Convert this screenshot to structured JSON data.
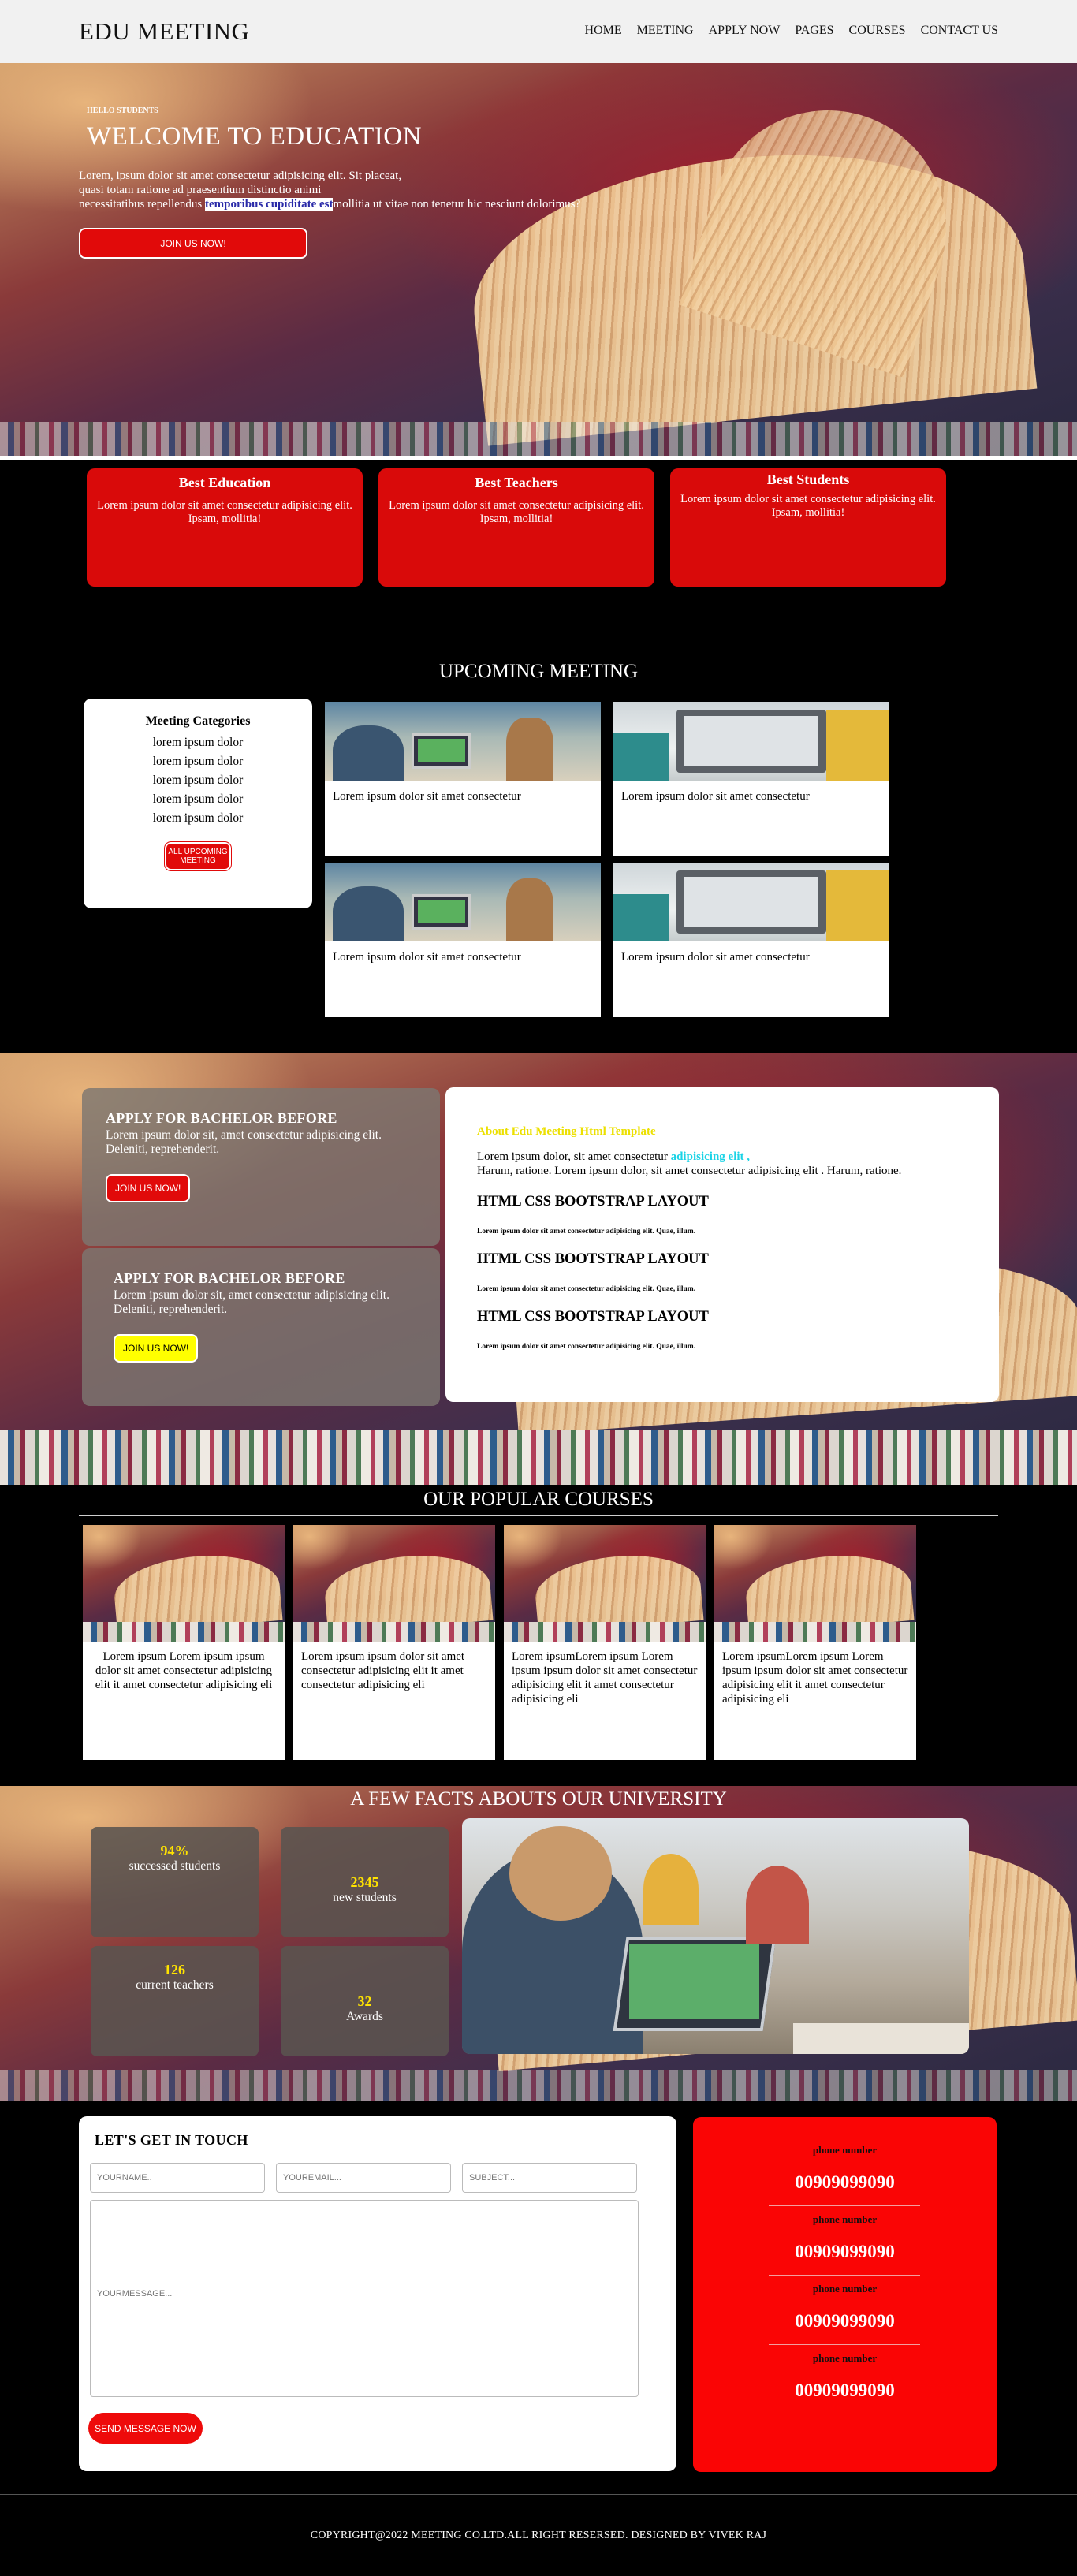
{
  "header": {
    "logo": "EDU MEETING",
    "nav": [
      "HOME",
      "MEETING",
      "APPLY NOW",
      "PAGES",
      "COURSES",
      "CONTACT US"
    ]
  },
  "hero": {
    "kicker": "HELLO STUDENTS",
    "title": "WELCOME TO EDUCATION",
    "text_line1": "Lorem, ipsum dolor sit amet consectetur adipisicing elit. Sit placeat,",
    "text_line2": "quasi totam ratione ad praesentium distinctio animi",
    "text_line3a": "necessitatibus repellendus",
    "text_highlight": "temporibus cupiditate est",
    "text_line3b": "mollitia ut vitae non tenetur hic nesciunt dolorimus?",
    "button": "JOIN US NOW!"
  },
  "features": [
    {
      "title": "Best Education",
      "text": "Lorem ipsum dolor sit amet consectetur adipisicing elit. Ipsam, mollitia!"
    },
    {
      "title": "Best Teachers",
      "text": "Lorem ipsum dolor sit amet consectetur adipisicing elit. Ipsam, mollitia!"
    },
    {
      "title": "Best Students",
      "text": "Lorem ipsum dolor sit amet consectetur adipisicing elit. Ipsam, mollitia!"
    }
  ],
  "upcoming": {
    "title": "UPCOMING MEETING",
    "categories_title": "Meeting Categories",
    "categories": [
      "lorem ipsum dolor",
      "lorem ipsum dolor",
      "lorem ipsum dolor",
      "lorem ipsum dolor",
      "lorem ipsum dolor"
    ],
    "categories_button": "ALL UPCOMING MEETING",
    "cards": [
      {
        "text": "Lorem ipsum dolor sit amet consectetur"
      },
      {
        "text": "Lorem ipsum dolor sit amet consectetur"
      },
      {
        "text": "Lorem ipsum dolor sit amet consectetur"
      },
      {
        "text": "Lorem ipsum dolor sit amet consectetur"
      }
    ]
  },
  "apply": [
    {
      "title": "APPLY FOR BACHELOR BEFORE",
      "text": "Lorem ipsum dolor sit, amet consectetur adipisicing elit. Deleniti, reprehenderit.",
      "button": "JOIN US NOW!",
      "button_color": "#e10a0a"
    },
    {
      "title": "APPLY FOR BACHELOR BEFORE",
      "text": "Lorem ipsum dolor sit, amet consectetur adipisicing elit. Deleniti, reprehenderit.",
      "button": "JOIN US NOW!",
      "button_color": "#ffff00"
    }
  ],
  "about": {
    "label": "About Edu Meeting Html Template",
    "body_a": "Lorem ipsum dolor, sit amet consectetur",
    "body_highlight": "adipisicing elit ,",
    "body_b": "Harum, ratione. Lorem ipsum dolor, sit amet consectetur adipisicing elit . Harum, ratione.",
    "items": [
      {
        "heading": "HTML CSS BOOTSTRAP LAYOUT",
        "text": "Lorem ipsum dolor sit amet consectetur adipisicing elit. Quae, illum."
      },
      {
        "heading": "HTML CSS BOOTSTRAP LAYOUT",
        "text": "Lorem ipsum dolor sit amet consectetur adipisicing elit. Quae, illum."
      },
      {
        "heading": "HTML CSS BOOTSTRAP LAYOUT",
        "text": "Lorem ipsum dolor sit amet consectetur adipisicing elit. Quae, illum."
      }
    ]
  },
  "courses": {
    "title": "OUR POPULAR COURSES",
    "items": [
      {
        "text": "Lorem ipsum Lorem ipsum ipsum dolor sit amet consectetur adipisicing elit it amet consectetur adipisicing eli",
        "align": "center"
      },
      {
        "text": "Lorem ipsum ipsum dolor sit amet consectetur adipisicing elit it amet consectetur adipisicing eli",
        "align": "left"
      },
      {
        "text": "Lorem ipsumLorem ipsum Lorem ipsum ipsum dolor sit amet consectetur adipisicing elit it amet consectetur adipisicing eli",
        "align": "left"
      },
      {
        "text": "Lorem ipsumLorem ipsum Lorem ipsum ipsum dolor sit amet consectetur adipisicing elit it amet consectetur adipisicing eli",
        "align": "left"
      }
    ]
  },
  "facts": {
    "title": "A FEW FACTS ABOUTS OUR UNIVERSITY",
    "items": [
      {
        "number": "94%",
        "label": "successed students"
      },
      {
        "number": "2345",
        "label": "new students"
      },
      {
        "number": "126",
        "label": "current teachers"
      },
      {
        "number": "32",
        "label": "Awards"
      }
    ]
  },
  "contact": {
    "title": "LET'S GET IN TOUCH",
    "name_placeholder": "YOURNAME..",
    "email_placeholder": "YOUREMAIL...",
    "subject_placeholder": "SUBJECT...",
    "message_placeholder": "YOURMESSAGE...",
    "send_button": "SEND MESSAGE NOW",
    "phones": [
      {
        "label": "phone number",
        "number": "00909099090"
      },
      {
        "label": "phone number",
        "number": "00909099090"
      },
      {
        "label": "phone number",
        "number": "00909099090"
      },
      {
        "label": "phone number",
        "number": "00909099090"
      }
    ]
  },
  "footer": {
    "text": "COPYRIGHT@2022 MEETING CO.LTD.ALL RIGHT RESERSED. DESIGNED BY VIVEK RAJ"
  }
}
